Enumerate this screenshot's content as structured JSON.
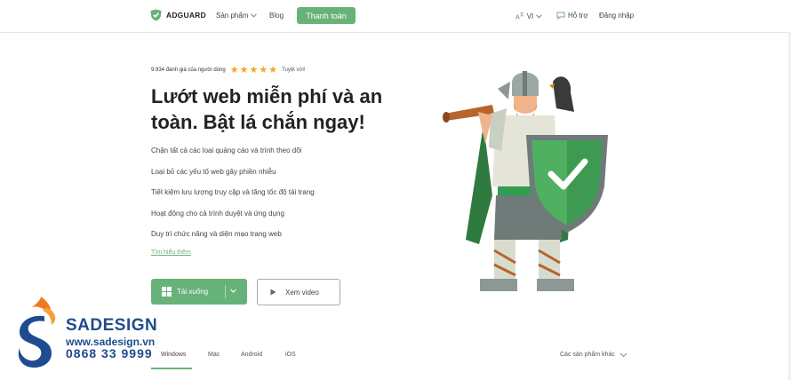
{
  "header": {
    "brand": "ADGUARD",
    "nav": {
      "products": "Sản phẩm",
      "blog": "Blog",
      "cta": "Thanh toán",
      "language": "VI",
      "support": "Hỗ trợ",
      "login": "Đăng nhập"
    }
  },
  "hero": {
    "rating": {
      "text": "9.934 đánh giá của người dùng",
      "stars": 5,
      "label": "Tuyệt vời!"
    },
    "title": "Lướt web miễn phí và an toàn. Bật lá chắn ngay!",
    "features": [
      "Chặn tất cả các loại quảng cáo và trình theo dõi",
      "Loại bỏ các yếu tố web gây phiền nhiễu",
      "Tiết kiệm lưu lượng truy cập và tăng tốc độ tải trang",
      "Hoạt động cho cả trình duyệt và ứng dụng",
      "Duy trì chức năng và diện mạo trang web"
    ],
    "learn_more": "Tìm hiểu thêm",
    "download_label": "Tải xuống",
    "video_label": "Xem video"
  },
  "tabs": {
    "items": [
      "Windows",
      "Mac",
      "Android",
      "iOS"
    ],
    "other_products": "Các sản phẩm khác"
  },
  "watermark": {
    "name": "SADESIGN",
    "url": "www.sadesign.vn",
    "phone": "0868 33 9999"
  },
  "colors": {
    "brand_green": "#67b279",
    "watermark_blue": "#1f4c8f",
    "watermark_orange": "#f07a1e"
  }
}
